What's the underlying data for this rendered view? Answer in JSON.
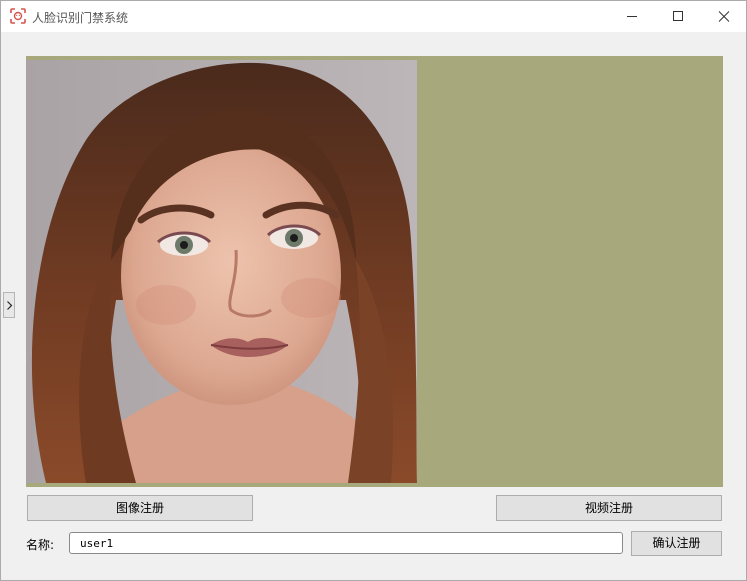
{
  "window": {
    "title": "人脸识别门禁系统",
    "app_icon": "face-scan-icon",
    "controls": [
      "minimize-icon",
      "maximize-icon",
      "close-icon"
    ]
  },
  "sidebar_toggle": {
    "glyph": "›",
    "icon": "chevron-right-icon"
  },
  "viewer": {
    "background_color": "#a7a87c",
    "image": "portrait-photo"
  },
  "buttons": {
    "image_register": "图像注册",
    "video_register": "视频注册",
    "confirm_register": "确认注册"
  },
  "form": {
    "name_label": "名称:",
    "name_value": "user1"
  },
  "colors": {
    "accent": "#d9534f",
    "button_bg": "#e1e1e1",
    "window_bg": "#f0f0f0"
  }
}
